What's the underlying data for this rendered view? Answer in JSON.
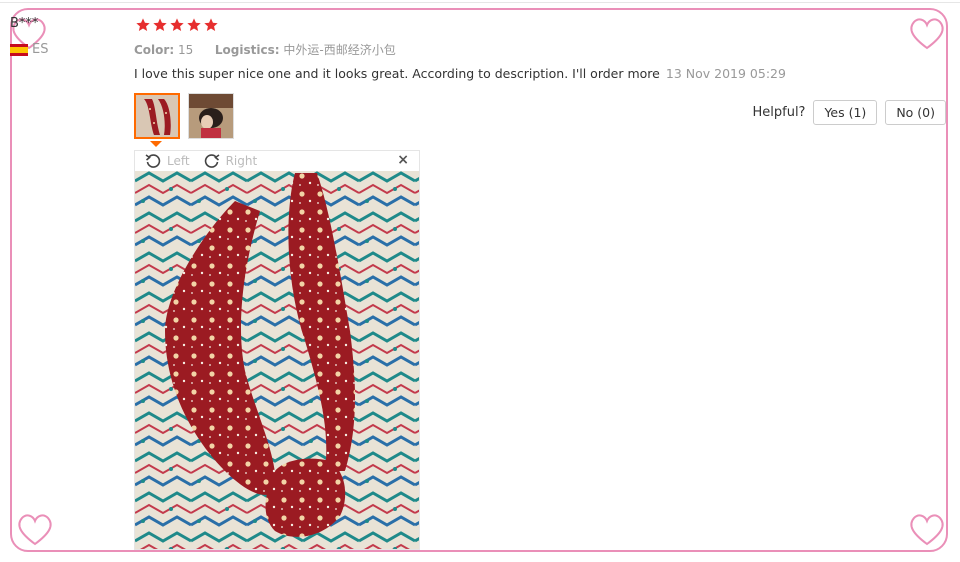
{
  "reviewer": {
    "name": "B***",
    "country_code": "ES"
  },
  "rating": {
    "stars": 5,
    "max": 5,
    "color": "#e62e2e"
  },
  "meta": {
    "color_label": "Color:",
    "color_value": "15",
    "logistics_label": "Logistics:",
    "logistics_value": "中外运-西邮经济小包"
  },
  "review": {
    "text": "I love this super nice one and it looks great. According to description. I'll order more",
    "date": "13 Nov 2019 05:29"
  },
  "helpful": {
    "label": "Helpful?",
    "yes": "Yes (1)",
    "no": "No (0)"
  },
  "viewer": {
    "left_label": "Left",
    "right_label": "Right",
    "close": "×"
  },
  "colors": {
    "frame_pink": "#ea8fb8",
    "accent": "#ff6a00",
    "fabric_red": "#9b1b22"
  }
}
